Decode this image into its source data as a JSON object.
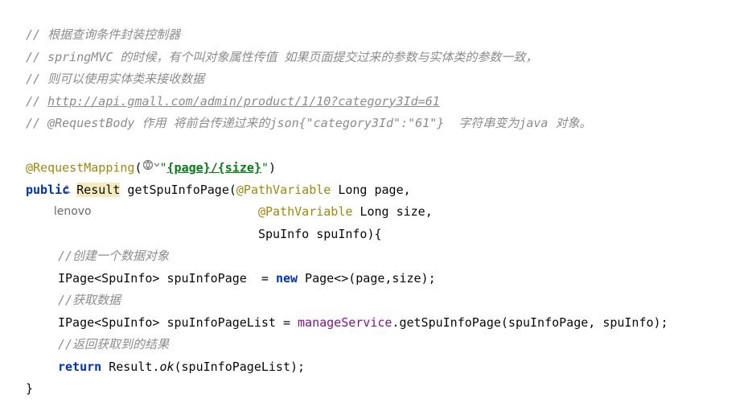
{
  "comments": [
    "// 根据查询条件封装控制器",
    "// springMVC 的时候，有个叫对象属性传值 如果页面提交过来的参数与实体类的参数一致，",
    "// 则可以使用实体类来接收数据",
    "// ",
    "// @RequestBody 作用 将前台传递过来的json{\"category3Id\":\"61\"}  字符串变为java 对象。"
  ],
  "comment_link": "http://api.gmall.com/admin/product/1/10?category3Id=61",
  "author": "lenovo",
  "code": {
    "annotation_mapping": "@RequestMapping",
    "paren_open": "(",
    "quote_open": "\"",
    "mapping_path": "{page}/{size}",
    "quote_close": "\"",
    "paren_close": ")",
    "kw_public": "public",
    "type_result": "Result",
    "method_sig_rest": " getSpuInfoPage(",
    "path_variable_1": "@PathVariable",
    "param_page": " Long page,",
    "path_variable_2": "@PathVariable",
    "param_size": " Long size,",
    "param_spuinfo": "SpuInfo spuInfo){",
    "comment_create": "//创建一个数据对象",
    "line_ipage_1_start": "IPage<SpuInfo> spuInfoPage  = ",
    "kw_new": "new",
    "line_ipage_1_end": " Page<>(page,size);",
    "comment_fetch": "//获取数据",
    "line_ipage_2_start": "IPage<SpuInfo> spuInfoPageList = ",
    "field_manage_service": "manageService",
    "line_ipage_2_end": ".getSpuInfoPage(spuInfoPage, spuInfo);",
    "comment_return": "//返回获取到的结果",
    "kw_return": "return",
    "return_result": " Result.",
    "method_ok": "ok",
    "return_args": "(spuInfoPageList);",
    "closing_brace": "}"
  },
  "colors": {
    "comment": "#8c8c8c",
    "keyword": "#0033b3",
    "annotation": "#9e880d",
    "string": "#067d17",
    "field": "#871094",
    "highlight": "#f6ebbc"
  }
}
